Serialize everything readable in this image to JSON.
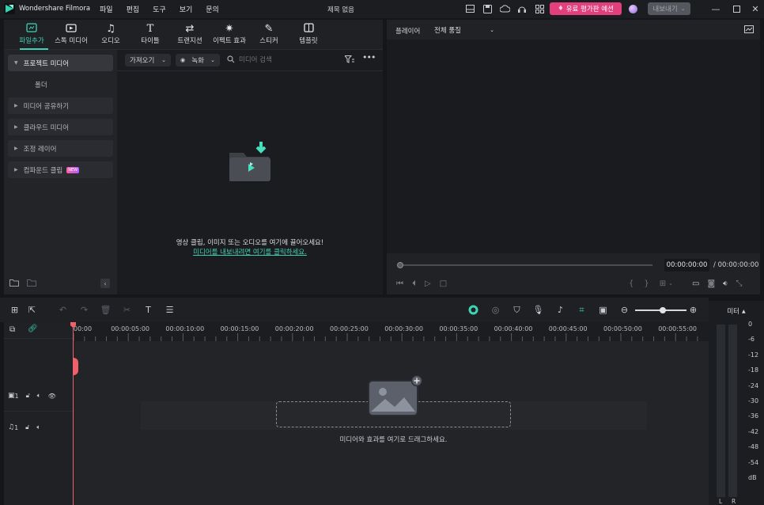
{
  "app": {
    "title": "Wondershare Filmora",
    "doc_title": "제목 없음",
    "logo_color": "#2fd6b2"
  },
  "menu": [
    "파일",
    "편집",
    "도구",
    "보기",
    "문의"
  ],
  "titlebar": {
    "upgrade_label": "유료 평가판 예션",
    "export_label": "내보내기",
    "icons": [
      "layout-icon",
      "save-icon",
      "cloud-icon",
      "headset-icon",
      "grid-icon"
    ]
  },
  "tabs": [
    {
      "label": "파일추가",
      "icon": "folder-media-icon",
      "active": true
    },
    {
      "label": "스톡 미디어",
      "icon": "stock-media-icon"
    },
    {
      "label": "오디오",
      "icon": "music-note-icon"
    },
    {
      "label": "타이틀",
      "icon": "text-icon"
    },
    {
      "label": "트랜지션",
      "icon": "transition-icon"
    },
    {
      "label": "이펙트 효과",
      "icon": "sparkle-icon"
    },
    {
      "label": "스티커",
      "icon": "sticker-icon"
    },
    {
      "label": "템플릿",
      "icon": "template-icon"
    }
  ],
  "sidebar": {
    "project_media": "프로젝트 미디어",
    "folder": "폴더",
    "items": [
      "미디어 공유하기",
      "클라우드 미디어",
      "조정 레이어",
      "컴파운드 클립"
    ],
    "new_badge": "NEW"
  },
  "media": {
    "import_label": "가져오기",
    "record_label": "녹화",
    "search_placeholder": "미디어 검색",
    "drop_text": "영상 클립, 이미지 또는 오디오를 여기에 끌어오세요!",
    "drop_link": "미디어를 내보내려면 여기를 클릭하세요."
  },
  "player": {
    "label": "플레이어",
    "quality": "전체 품질",
    "current_time": "00:00:00:00",
    "total_time": "/ 00:00:00:00"
  },
  "ruler": [
    "00:00",
    "00:00:05:00",
    "00:00:10:00",
    "00:00:15:00",
    "00:00:20:00",
    "00:00:25:00",
    "00:00:30:00",
    "00:00:35:00",
    "00:00:40:00",
    "00:00:45:00",
    "00:00:50:00",
    "00:00:55:00"
  ],
  "tracks": {
    "video_num": "1",
    "audio_num": "1"
  },
  "timeline": {
    "drop_text": "미디어와 효과를 여기로 드래그하세요."
  },
  "meter": {
    "label": "미터",
    "scale": [
      "0",
      "-6",
      "-12",
      "-18",
      "-24",
      "-30",
      "-36",
      "-42",
      "-48",
      "-54",
      "dB"
    ],
    "left": "L",
    "right": "R"
  }
}
